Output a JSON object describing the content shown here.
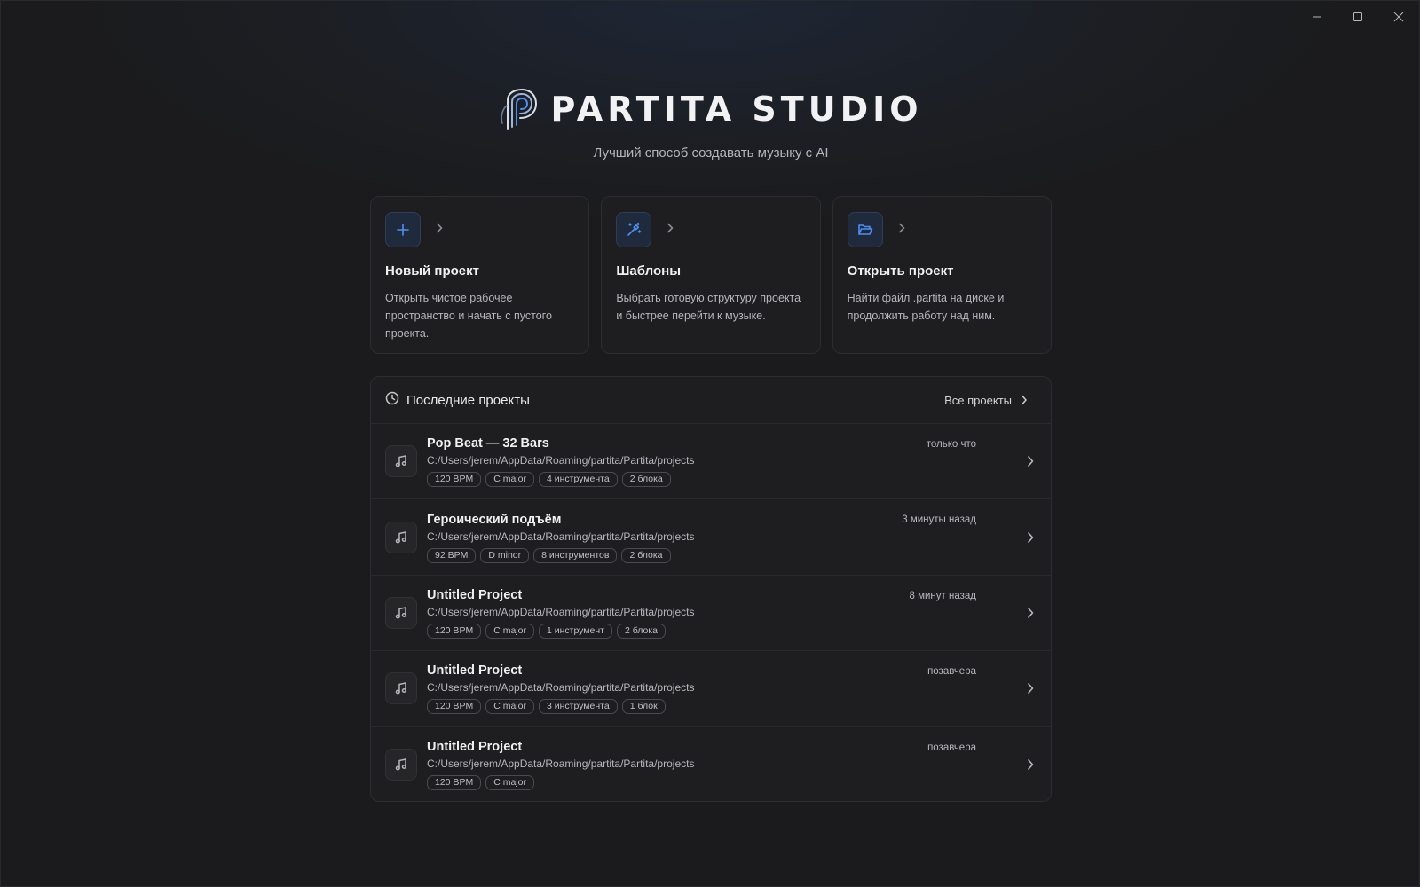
{
  "window": {
    "controls": {
      "minimize": "minimize",
      "maximize": "maximize",
      "close": "close"
    }
  },
  "brand": {
    "name": "PARTITA STUDIO",
    "tagline": "Лучший способ создавать музыку с AI",
    "logo_icon": "partita-logo-icon"
  },
  "colors": {
    "accent": "#4f8ff5",
    "background": "#1b1b1d",
    "card": "#1e1e21"
  },
  "cards": [
    {
      "icon": "plus-icon",
      "title": "Новый проект",
      "description": "Открыть чистое рабочее пространство и начать с пустого проекта."
    },
    {
      "icon": "magic-wand-icon",
      "title": "Шаблоны",
      "description": "Выбрать готовую структуру проекта и быстрее перейти к музыке."
    },
    {
      "icon": "folder-open-icon",
      "title": "Открыть проект",
      "description": "Найти файл .partita на диске и продолжить работу над ним."
    }
  ],
  "recent": {
    "title": "Последние проекты",
    "all_label": "Все проекты",
    "items": [
      {
        "name": "Pop Beat — 32 Bars",
        "path": "C:/Users/jerem/AppData/Roaming/partita/Partita/projects",
        "time": "только что",
        "tags": [
          "120 BPM",
          "C major",
          "4 инструмента",
          "2 блока"
        ]
      },
      {
        "name": "Героический подъём",
        "path": "C:/Users/jerem/AppData/Roaming/partita/Partita/projects",
        "time": "3 минуты назад",
        "tags": [
          "92 BPM",
          "D minor",
          "8 инструментов",
          "2 блока"
        ]
      },
      {
        "name": "Untitled Project",
        "path": "C:/Users/jerem/AppData/Roaming/partita/Partita/projects",
        "time": "8 минут назад",
        "tags": [
          "120 BPM",
          "C major",
          "1 инструмент",
          "2 блока"
        ]
      },
      {
        "name": "Untitled Project",
        "path": "C:/Users/jerem/AppData/Roaming/partita/Partita/projects",
        "time": "позавчера",
        "tags": [
          "120 BPM",
          "C major",
          "3 инструмента",
          "1 блок"
        ]
      },
      {
        "name": "Untitled Project",
        "path": "C:/Users/jerem/AppData/Roaming/partita/Partita/projects",
        "time": "позавчера",
        "tags": [
          "120 BPM",
          "C major"
        ]
      }
    ]
  }
}
